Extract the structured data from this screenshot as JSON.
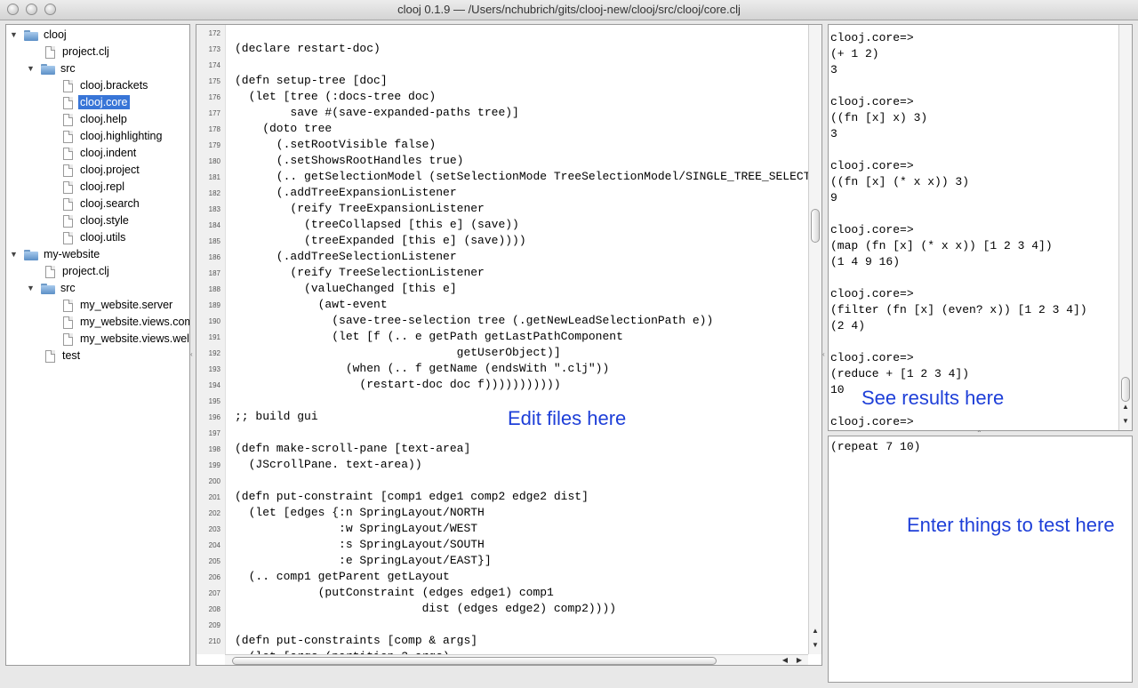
{
  "window": {
    "title": "clooj 0.1.9 —  /Users/nchubrich/gits/clooj-new/clooj/src/clooj/core.clj"
  },
  "tree": {
    "clooj": "clooj",
    "clooj_project": "project.clj",
    "clooj_src": "src",
    "files": [
      "clooj.brackets",
      "clooj.core",
      "clooj.help",
      "clooj.highlighting",
      "clooj.indent",
      "clooj.project",
      "clooj.repl",
      "clooj.search",
      "clooj.style",
      "clooj.utils"
    ],
    "mysite": "my-website",
    "mysite_project": "project.clj",
    "mysite_src": "src",
    "site_files": [
      "my_website.server",
      "my_website.views.com",
      "my_website.views.wel"
    ],
    "test": "test",
    "selected": "clooj.core"
  },
  "editor": {
    "line_numbers": [
      "172",
      "173",
      "174",
      "175",
      "176",
      "177",
      "178",
      "179",
      "180",
      "181",
      "182",
      "183",
      "184",
      "185",
      "186",
      "187",
      "188",
      "189",
      "190",
      "191",
      "192",
      "193",
      "194",
      "195",
      "196",
      "197",
      "198",
      "199",
      "200",
      "201",
      "202",
      "203",
      "204",
      "205",
      "206",
      "207",
      "208",
      "209",
      "210"
    ],
    "lines": [
      "",
      "(declare restart-doc)",
      "",
      "(defn setup-tree [doc]",
      "  (let [tree (:docs-tree doc)",
      "        save #(save-expanded-paths tree)]",
      "    (doto tree",
      "      (.setRootVisible false)",
      "      (.setShowsRootHandles true)",
      "      (.. getSelectionModel (setSelectionMode TreeSelectionModel/SINGLE_TREE_SELECTION))",
      "      (.addTreeExpansionListener",
      "        (reify TreeExpansionListener",
      "          (treeCollapsed [this e] (save))",
      "          (treeExpanded [this e] (save))))",
      "      (.addTreeSelectionListener",
      "        (reify TreeSelectionListener",
      "          (valueChanged [this e]",
      "            (awt-event",
      "              (save-tree-selection tree (.getNewLeadSelectionPath e))",
      "              (let [f (.. e getPath getLastPathComponent",
      "                                getUserObject)]",
      "                (when (.. f getName (endsWith \".clj\"))",
      "                  (restart-doc doc f)))))))))))",
      "",
      ";; build gui",
      "",
      "(defn make-scroll-pane [text-area]",
      "  (JScrollPane. text-area))",
      "",
      "(defn put-constraint [comp1 edge1 comp2 edge2 dist]",
      "  (let [edges {:n SpringLayout/NORTH",
      "               :w SpringLayout/WEST",
      "               :s SpringLayout/SOUTH",
      "               :e SpringLayout/EAST}]",
      "  (.. comp1 getParent getLayout",
      "            (putConstraint (edges edge1) comp1",
      "                           dist (edges edge2) comp2))))",
      "",
      "(defn put-constraints [comp & args]"
    ],
    "partial_line": "  (let [args (partition 3 args)",
    "annotation": "Edit files here"
  },
  "repl": {
    "lines": [
      "clooj.core=>",
      "(+ 1 2)",
      "3",
      "",
      "clooj.core=>",
      "((fn [x] x) 3)",
      "3",
      "",
      "clooj.core=>",
      "((fn [x] (* x x)) 3)",
      "9",
      "",
      "clooj.core=>",
      "(map (fn [x] (* x x)) [1 2 3 4])",
      "(1 4 9 16)",
      "",
      "clooj.core=>",
      "(filter (fn [x] (even? x)) [1 2 3 4])",
      "(2 4)",
      "",
      "clooj.core=>",
      "(reduce + [1 2 3 4])",
      "10",
      "",
      "clooj.core=>"
    ],
    "annotation": "See results here"
  },
  "input": {
    "text": "(repeat 7 10)",
    "annotation": "Enter things to test here"
  },
  "icons": {
    "window_controls": [
      "close-button-icon",
      "minimize-button-icon",
      "zoom-button-icon"
    ],
    "tree": [
      "folder-icon",
      "file-icon",
      "disclosure-triangle-icon"
    ],
    "scrollbar": [
      "arrow-left-icon",
      "arrow-right-icon",
      "arrow-up-icon",
      "arrow-down-icon"
    ]
  },
  "colors": {
    "selection": "#3875d7",
    "annotation": "#1e3fd8"
  }
}
